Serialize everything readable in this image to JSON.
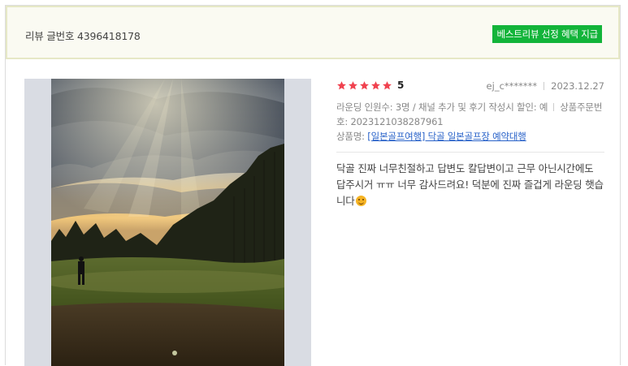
{
  "header": {
    "review_number": "리뷰 글번호 4396418178",
    "best_badge": "베스트리뷰 선정  혜택 지급"
  },
  "review": {
    "rating": 5,
    "rating_text": "5",
    "author": "ej_c*******",
    "date": "2023.12.27",
    "rounding_info": "라운딩 인원수: 3명 / 채널 추가 및 후기 작성시 할인: 예",
    "order_info": "상품주문번호: 2023121038287961",
    "product_label": "상품명: ",
    "product_link": "[일본골프여행] 닥골 일본골프장 예약대행",
    "text": "닥골 진짜 너무친절하고 답변도 칼답변이고 근무 아닌시간에도 답주시거 ㅠㅠ 너무 감사드려요! 덕분에 진짜 즐겁게 라운딩 햇습니다"
  },
  "photo": {
    "icon": "review-photo-golf-course"
  },
  "colors": {
    "badge": "#12b43a",
    "star": "#f0424f",
    "link": "#2a63c9"
  }
}
